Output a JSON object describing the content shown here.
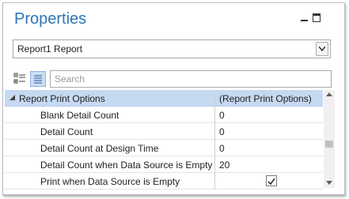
{
  "window": {
    "title": "Properties"
  },
  "selector": {
    "value": "Report1  Report"
  },
  "search": {
    "placeholder": "Search"
  },
  "category": {
    "name": "Report Print Options",
    "value": "(Report Print Options)"
  },
  "properties": [
    {
      "name": "Blank Detail Count",
      "value": "0"
    },
    {
      "name": "Detail Count",
      "value": "0"
    },
    {
      "name": "Detail Count at Design Time",
      "value": "0"
    },
    {
      "name": "Detail Count when Data Source is Empty",
      "value": "20"
    },
    {
      "name": "Print when Data Source is Empty",
      "checked": true
    }
  ],
  "colors": {
    "title": "#2f75b5",
    "category_bg": "#c5d9f1",
    "active_toolbar": "#c9def5"
  },
  "icons": [
    "pin-icon",
    "maximize-icon",
    "dropdown-arrow-icon",
    "categorized-view-icon",
    "alphabetical-view-icon",
    "collapse-triangle-icon",
    "checkbox-checked-icon"
  ]
}
